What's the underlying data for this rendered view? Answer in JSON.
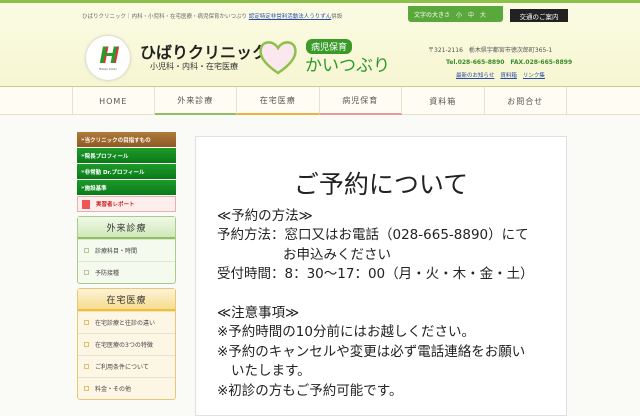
{
  "header": {
    "tagline": "ひばりクリニック｜内科・小児科・在宅医療・病児保育かいつぶり",
    "tagline_link": "認定特定非営利活動法人うりずん",
    "tagline_suffix": "併設",
    "font_size_label": "文字の大きさ",
    "font_sizes": [
      "小",
      "中",
      "大"
    ],
    "access_button": "交通のご案内",
    "logo_text": "Hibari Clinic",
    "clinic_name": "ひばりクリニック",
    "clinic_sub": "小児科・内科・在宅医療",
    "kaitsuburi_badge": "病児保育",
    "kaitsuburi_name": "かいつぶり",
    "address": "〒321-2116　栃木県宇都宮市徳次郎町365-1",
    "tel": "Tel.028-665-8890　FAX.028-665-8899",
    "links": [
      "最新のお知らせ",
      "資料箱",
      "リンク集"
    ]
  },
  "nav": [
    "HOME",
    "外来診療",
    "在宅医療",
    "病児保育",
    "資料箱",
    "お問合せ"
  ],
  "nav_colors": [
    "#fffdf3",
    "#8cc060",
    "#f0b040",
    "#e89898",
    "#fffdf3",
    "#fffdf3"
  ],
  "sidebar": {
    "top": [
      "当クリニックの目指すもの",
      "院長プロフィール",
      "非常勤 Dr.プロフィール",
      "施設基準"
    ],
    "report": "実習者レポート",
    "outpatient": {
      "title": "外来診療",
      "items": [
        "診療科目・時間",
        "予防接種"
      ]
    },
    "homecare": {
      "title": "在宅医療",
      "items": [
        "在宅診療と往診の違い",
        "在宅医療の3つの特徴",
        "ご利用条件について",
        "料金・その他"
      ]
    }
  },
  "main": {
    "title": "ご予約について",
    "lines": [
      "≪予約の方法≫",
      "予約方法：窓口又はお電話（028-665-8890）にて",
      "お申込みください",
      "受付時間：8：30〜17：00（月・火・木・金・土）",
      "≪注意事項≫",
      "※予約時間の10分前にはお越しください。",
      "※予約のキャンセルや変更は必ず電話連絡をお願い",
      "いたします。",
      "※初診の方もご予約可能です。"
    ]
  }
}
